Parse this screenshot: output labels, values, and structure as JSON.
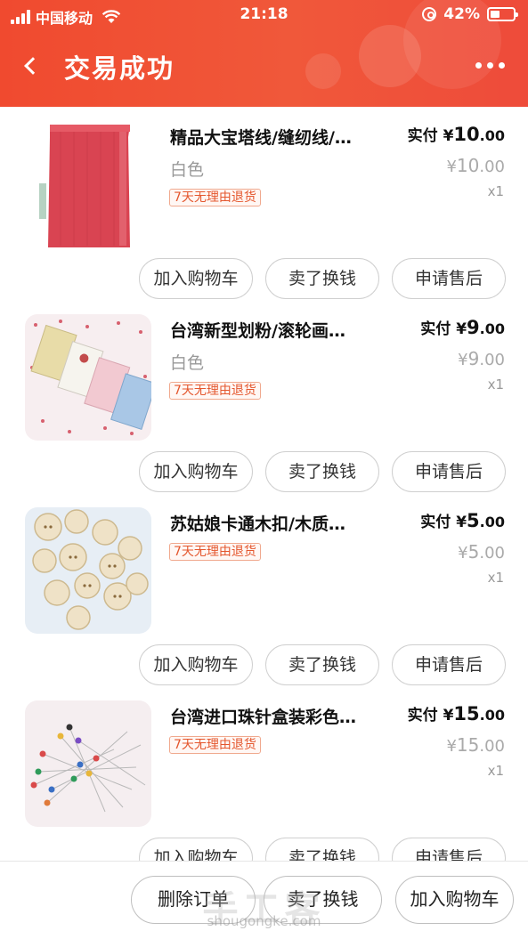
{
  "status_bar": {
    "carrier": "中国移动",
    "time": "21:18",
    "battery": "42%",
    "battery_level": 0.42
  },
  "nav": {
    "title": "交易成功"
  },
  "items": [
    {
      "name": "精品大宝塔线/缝纫线/…",
      "spec": "白色",
      "tag": "7天无理由退货",
      "paid_label": "实付",
      "currency": "¥",
      "paid_int": "10",
      "paid_dec": ".00",
      "orig_int": "10",
      "orig_dec": ".00",
      "qty": "x1",
      "buttons": [
        "加入购物车",
        "卖了换钱",
        "申请售后"
      ]
    },
    {
      "name": "台湾新型划粉/滚轮画…",
      "spec": "白色",
      "tag": "7天无理由退货",
      "paid_label": "实付",
      "currency": "¥",
      "paid_int": "9",
      "paid_dec": ".00",
      "orig_int": "9",
      "orig_dec": ".00",
      "qty": "x1",
      "buttons": [
        "加入购物车",
        "卖了换钱",
        "申请售后"
      ]
    },
    {
      "name": "苏姑娘卡通木扣/木质…",
      "spec": "",
      "tag": "7天无理由退货",
      "paid_label": "实付",
      "currency": "¥",
      "paid_int": "5",
      "paid_dec": ".00",
      "orig_int": "5",
      "orig_dec": ".00",
      "qty": "x1",
      "buttons": [
        "加入购物车",
        "卖了换钱",
        "申请售后"
      ]
    },
    {
      "name": "台湾进口珠针盒装彩色…",
      "spec": "",
      "tag": "7天无理由退货",
      "paid_label": "实付",
      "currency": "¥",
      "paid_int": "15",
      "paid_dec": ".00",
      "orig_int": "15",
      "orig_dec": ".00",
      "qty": "x1",
      "buttons": [
        "加入购物车",
        "卖了换钱",
        "申请售后"
      ]
    }
  ],
  "footer": {
    "delete_order": "删除订单",
    "sell": "卖了换钱",
    "add_cart": "加入购物车"
  },
  "watermark": {
    "text": "手工客",
    "url": "shougongke.com"
  },
  "colors": {
    "header": "#f04a2f",
    "tag": "#e4572e"
  }
}
